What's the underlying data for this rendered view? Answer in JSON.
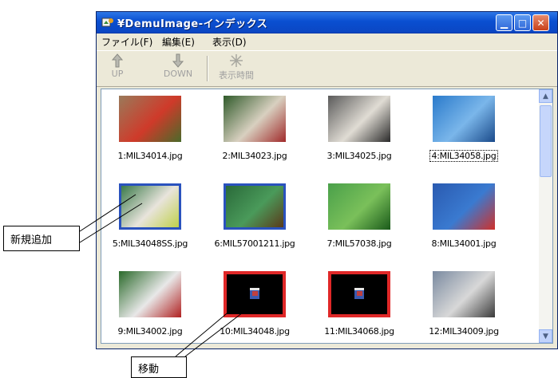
{
  "window": {
    "title": "¥DemuImage-インデックス",
    "controls": {
      "minimize_icon": "minimize-icon",
      "maximize_icon": "maximize-icon",
      "close_icon": "close-icon"
    }
  },
  "menu": [
    "ファイル(F)",
    "編集(E)",
    "表示(D)"
  ],
  "toolbar": [
    {
      "label": "UP",
      "icon": "up-arrow-icon",
      "enabled": false
    },
    {
      "label": "DOWN",
      "icon": "down-arrow-icon",
      "enabled": false
    },
    {
      "label": "表示時間",
      "icon": "sparkle-icon",
      "enabled": false
    }
  ],
  "items": [
    {
      "label": "1:MIL34014.jpg",
      "frame": "none",
      "colors": [
        "#9a7a5a",
        "#cf3a2a",
        "#4a6a2a"
      ]
    },
    {
      "label": "2:MIL34023.jpg",
      "frame": "none",
      "colors": [
        "#2f5a2a",
        "#d8d0c0",
        "#a02a2a"
      ]
    },
    {
      "label": "3:MIL34025.jpg",
      "frame": "none",
      "colors": [
        "#5a5a5a",
        "#e0dcd4",
        "#2a2a2a"
      ]
    },
    {
      "label": "4:MIL34058.jpg",
      "frame": "none",
      "focused": true,
      "colors": [
        "#2a7acb",
        "#7ab6ea",
        "#1a4a8a"
      ]
    },
    {
      "label": "5:MIL34048SS.jpg",
      "frame": "blue",
      "colors": [
        "#3a7a4a",
        "#e8e4dc",
        "#bfd04a"
      ]
    },
    {
      "label": "6:MIL57001211.jpg",
      "frame": "blue",
      "colors": [
        "#2a6a3a",
        "#4a9a5a",
        "#5a3a1a"
      ]
    },
    {
      "label": "7:MIL57038.jpg",
      "frame": "none",
      "colors": [
        "#4aa04a",
        "#7ac05a",
        "#1a5a1a"
      ]
    },
    {
      "label": "8:MIL34001.jpg",
      "frame": "none",
      "colors": [
        "#2a5ab0",
        "#3a7ad0",
        "#d0302a"
      ]
    },
    {
      "label": "9:MIL34002.jpg",
      "frame": "none",
      "colors": [
        "#2a6a2a",
        "#e8e8e8",
        "#b02020"
      ]
    },
    {
      "label": "10:MIL34048.jpg",
      "frame": "red",
      "colors": [
        "#000000",
        "#3a5ab0",
        "#c04040"
      ]
    },
    {
      "label": "11:MIL34068.jpg",
      "frame": "red",
      "colors": [
        "#000000",
        "#3a5ab0",
        "#c04040"
      ]
    },
    {
      "label": "12:MIL34009.jpg",
      "frame": "none",
      "colors": [
        "#7a8aa0",
        "#d8d8d8",
        "#3a3a3a"
      ]
    }
  ],
  "callouts": {
    "add": "新規追加",
    "move": "移動"
  },
  "colors": {
    "titlebar": "#0a4fd1",
    "frame_blue": "#2a52be",
    "frame_red": "#e02828"
  }
}
